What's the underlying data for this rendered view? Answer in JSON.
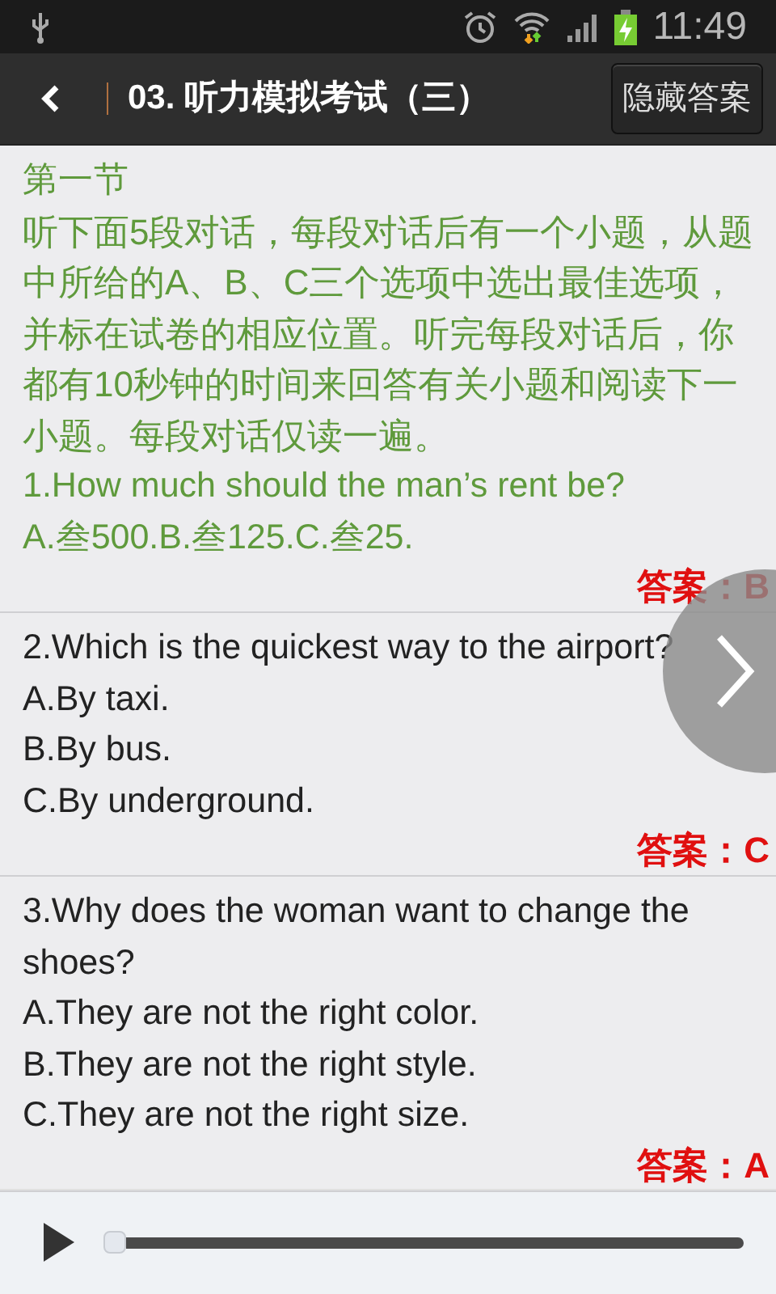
{
  "status_bar": {
    "time": "11:49"
  },
  "header": {
    "title": "03. 听力模拟考试（三）",
    "button": "隐藏答案"
  },
  "questions": [
    {
      "kind": "intro",
      "heading": "第一节",
      "instructions": "听下面5段对话，每段对话后有一个小题，从题中所给的A、B、C三个选项中选出最佳选项，并标在试卷的相应位置。听完每段对话后，你都有10秒钟的时间来回答有关小题和阅读下一小题。每段对话仅读一遍。",
      "lines": [
        "1.How much should the man’s rent be?",
        "A.叁500.B.叁125.C.叁25."
      ],
      "answer": "答案：B"
    },
    {
      "kind": "plain",
      "lines": [
        "2.Which is the quickest way to the airport?",
        "A.By taxi.",
        "B.By bus.",
        "C.By underground."
      ],
      "answer": "答案：C"
    },
    {
      "kind": "plain",
      "lines": [
        "3.Why does the woman want to change the shoes?",
        "A.They are not the right color.",
        "B.They are not the right style.",
        "C.They are not the right size."
      ],
      "answer": "答案：A"
    }
  ],
  "player": {
    "playing": false,
    "level": 0.0
  }
}
